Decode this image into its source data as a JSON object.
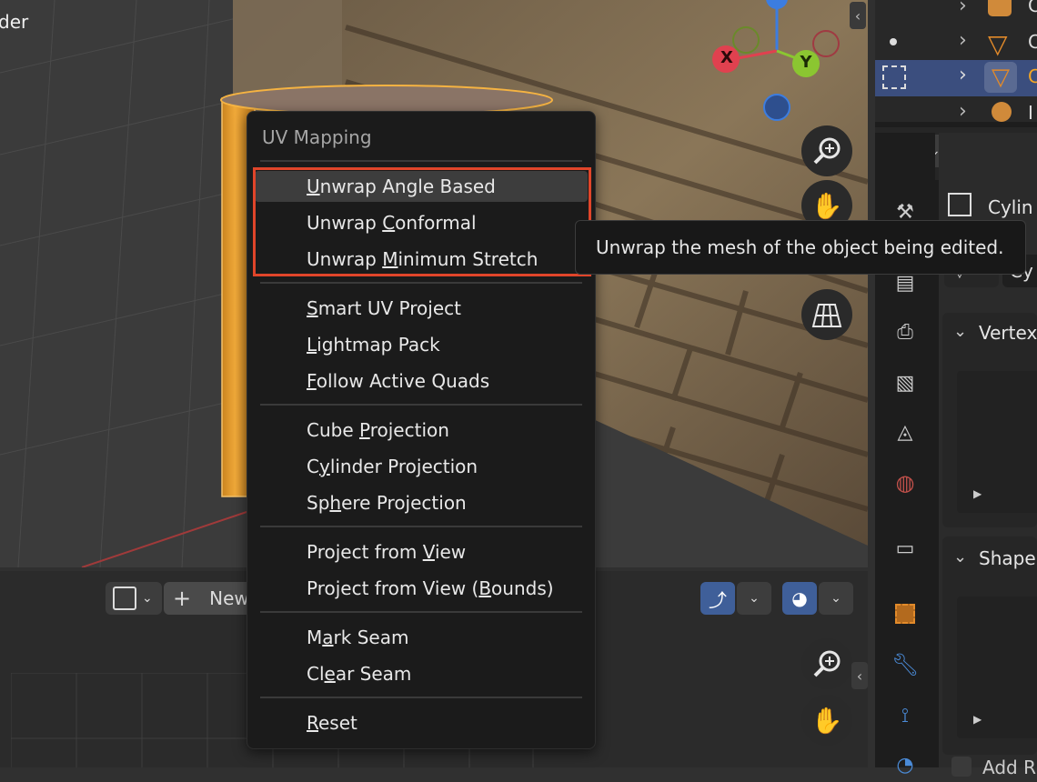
{
  "viewport": {
    "label": "der",
    "gizmo": {
      "x": "X",
      "y": "Y"
    }
  },
  "uv_header": {
    "new_label": "New"
  },
  "menu": {
    "title": "UV Mapping",
    "groups": [
      [
        {
          "label": "Unwrap Angle Based",
          "underline": "U",
          "highlighted": true
        },
        {
          "label": "Unwrap Conformal",
          "underline": "C"
        },
        {
          "label": "Unwrap Minimum Stretch",
          "underline": "M"
        }
      ],
      [
        {
          "label": "Smart UV Project",
          "underline": "S"
        },
        {
          "label": "Lightmap Pack",
          "underline": "L"
        },
        {
          "label": "Follow Active Quads",
          "underline": "F"
        }
      ],
      [
        {
          "label": "Cube Projection",
          "underline": "P"
        },
        {
          "label": "Cylinder Projection",
          "underline": "y"
        },
        {
          "label": "Sphere Projection",
          "underline": "h"
        }
      ],
      [
        {
          "label": "Project from View",
          "underline": "V"
        },
        {
          "label": "Project from View (Bounds)",
          "underline": "B"
        }
      ],
      [
        {
          "label": "Mark Seam",
          "underline": "a"
        },
        {
          "label": "Clear Seam",
          "underline": "e"
        }
      ],
      [
        {
          "label": "Reset",
          "underline": "R"
        }
      ]
    ]
  },
  "tooltip": {
    "text": "Unwrap the mesh of the object being edited."
  },
  "properties": {
    "object_name": "Cylin",
    "data_name": "Cy",
    "panel_vertex": "Vertex",
    "panel_shape": "Shape",
    "add_label": "Add R"
  },
  "outliner": {
    "row_letters": [
      "C",
      "C",
      "C",
      "I"
    ]
  },
  "colors": {
    "highlight_border": "#e0452a",
    "selection_orange": "#f5a623",
    "axis_x": "#e0414f",
    "axis_y": "#8bc631",
    "axis_z": "#3c7de0"
  }
}
